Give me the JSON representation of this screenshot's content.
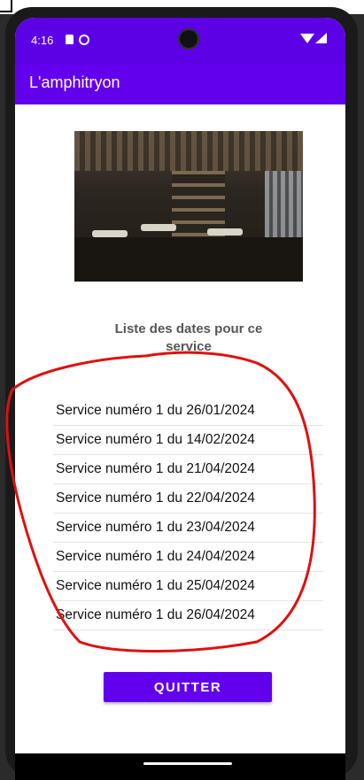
{
  "status_bar": {
    "time": "4:16"
  },
  "app_bar": {
    "title": "L'amphitryon"
  },
  "section": {
    "title": "Liste des dates pour ce service"
  },
  "services": [
    "Service numéro 1 du 26/01/2024",
    "Service numéro 1 du 14/02/2024",
    "Service numéro 1 du 21/04/2024",
    "Service numéro 1 du 22/04/2024",
    "Service numéro 1 du 23/04/2024",
    "Service numéro 1 du 24/04/2024",
    "Service numéro 1 du 25/04/2024",
    "Service numéro 1 du 26/04/2024"
  ],
  "actions": {
    "quit_label": "QUITTER"
  },
  "colors": {
    "primary": "#6200ee",
    "status_bar": "#5c00e6",
    "annotation": "#e01010"
  },
  "icons": [
    "sim-card-icon",
    "sync-icon",
    "wifi-icon",
    "signal-icon"
  ]
}
